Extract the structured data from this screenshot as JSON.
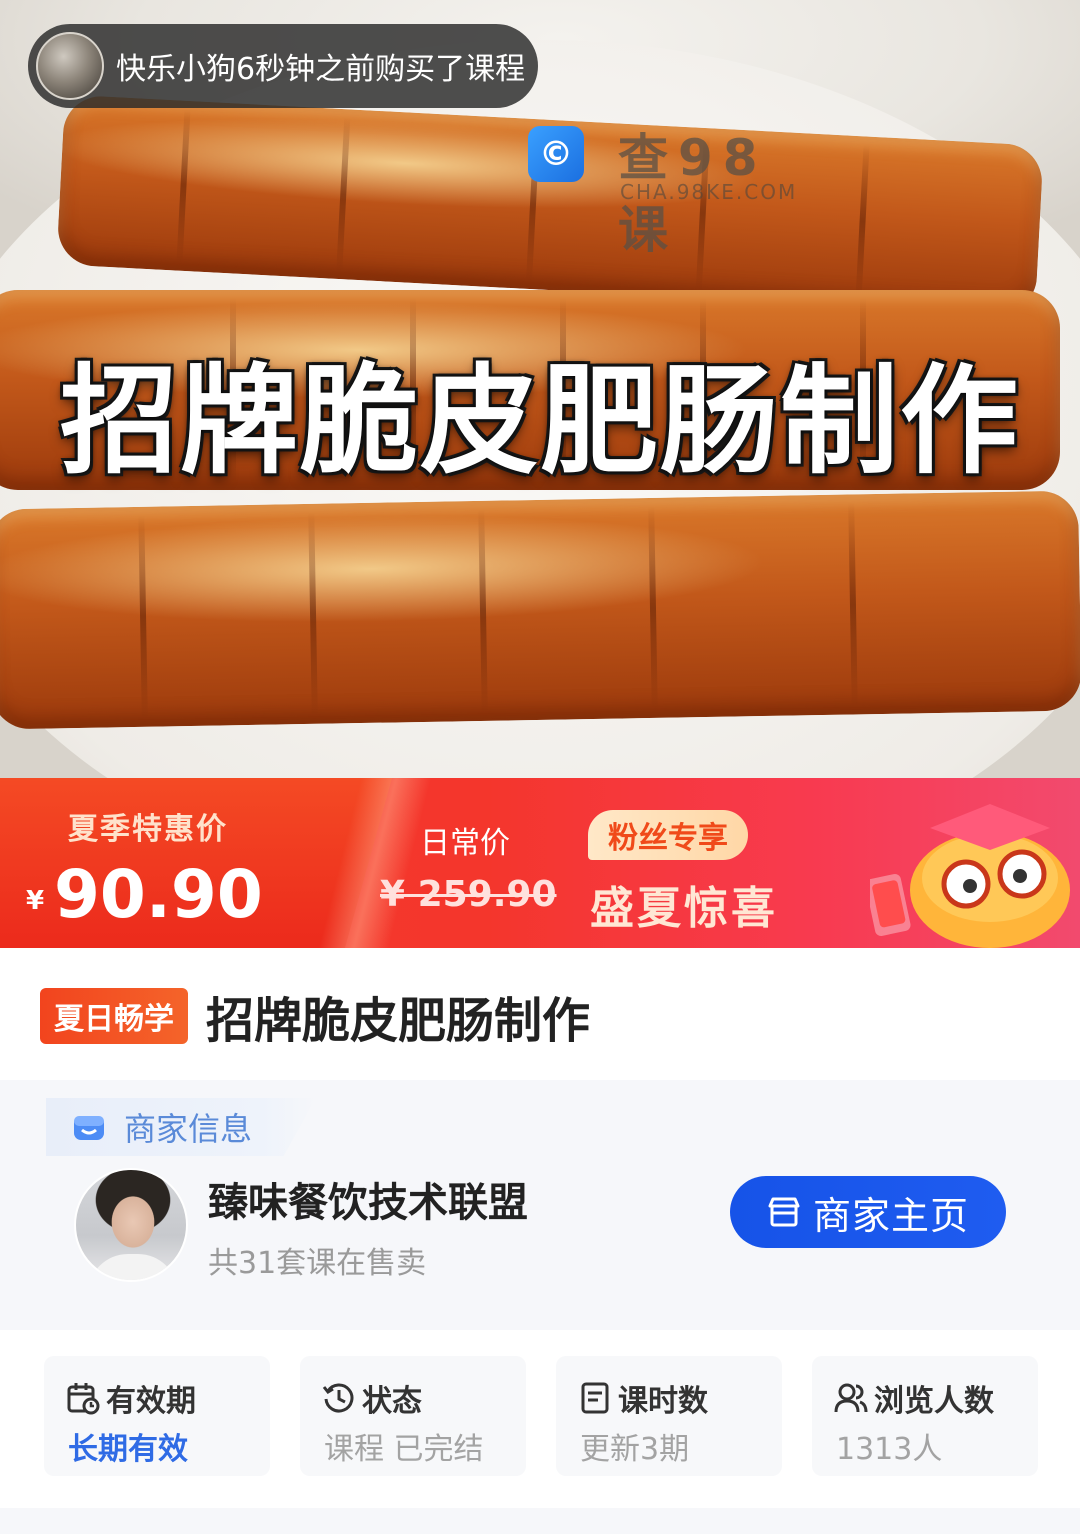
{
  "hero": {
    "title": "招牌脆皮肥肠制作",
    "toast": "快乐小狗6秒钟之前购买了课程",
    "watermark_title": "查98课",
    "watermark_sub": "CHA.98KE.COM"
  },
  "promo": {
    "label_left": "夏季特惠价",
    "currency": "¥",
    "price": "90.90",
    "label_mid": "日常价",
    "old_price": "¥ 259.90",
    "badge": "粉丝专享",
    "slogan": "盛夏惊喜"
  },
  "course": {
    "tag": "夏日畅学",
    "title": "招牌脆皮肥肠制作"
  },
  "merchant": {
    "header": "商家信息",
    "name": "臻味餐饮技术联盟",
    "count": "共31套课在售卖",
    "home_button": "商家主页"
  },
  "stats": [
    {
      "icon": "calendar-icon",
      "label": "有效期",
      "value": "长期有效"
    },
    {
      "icon": "clock-icon",
      "label": "状态",
      "value": "课程 已完结"
    },
    {
      "icon": "document-icon",
      "label": "课时数",
      "value": "更新3期"
    },
    {
      "icon": "users-icon",
      "label": "浏览人数",
      "value": "1313人"
    }
  ],
  "colors": {
    "promo_red": "#f23a2a",
    "primary_blue": "#1653e8",
    "tag_orange": "#f2441e"
  }
}
